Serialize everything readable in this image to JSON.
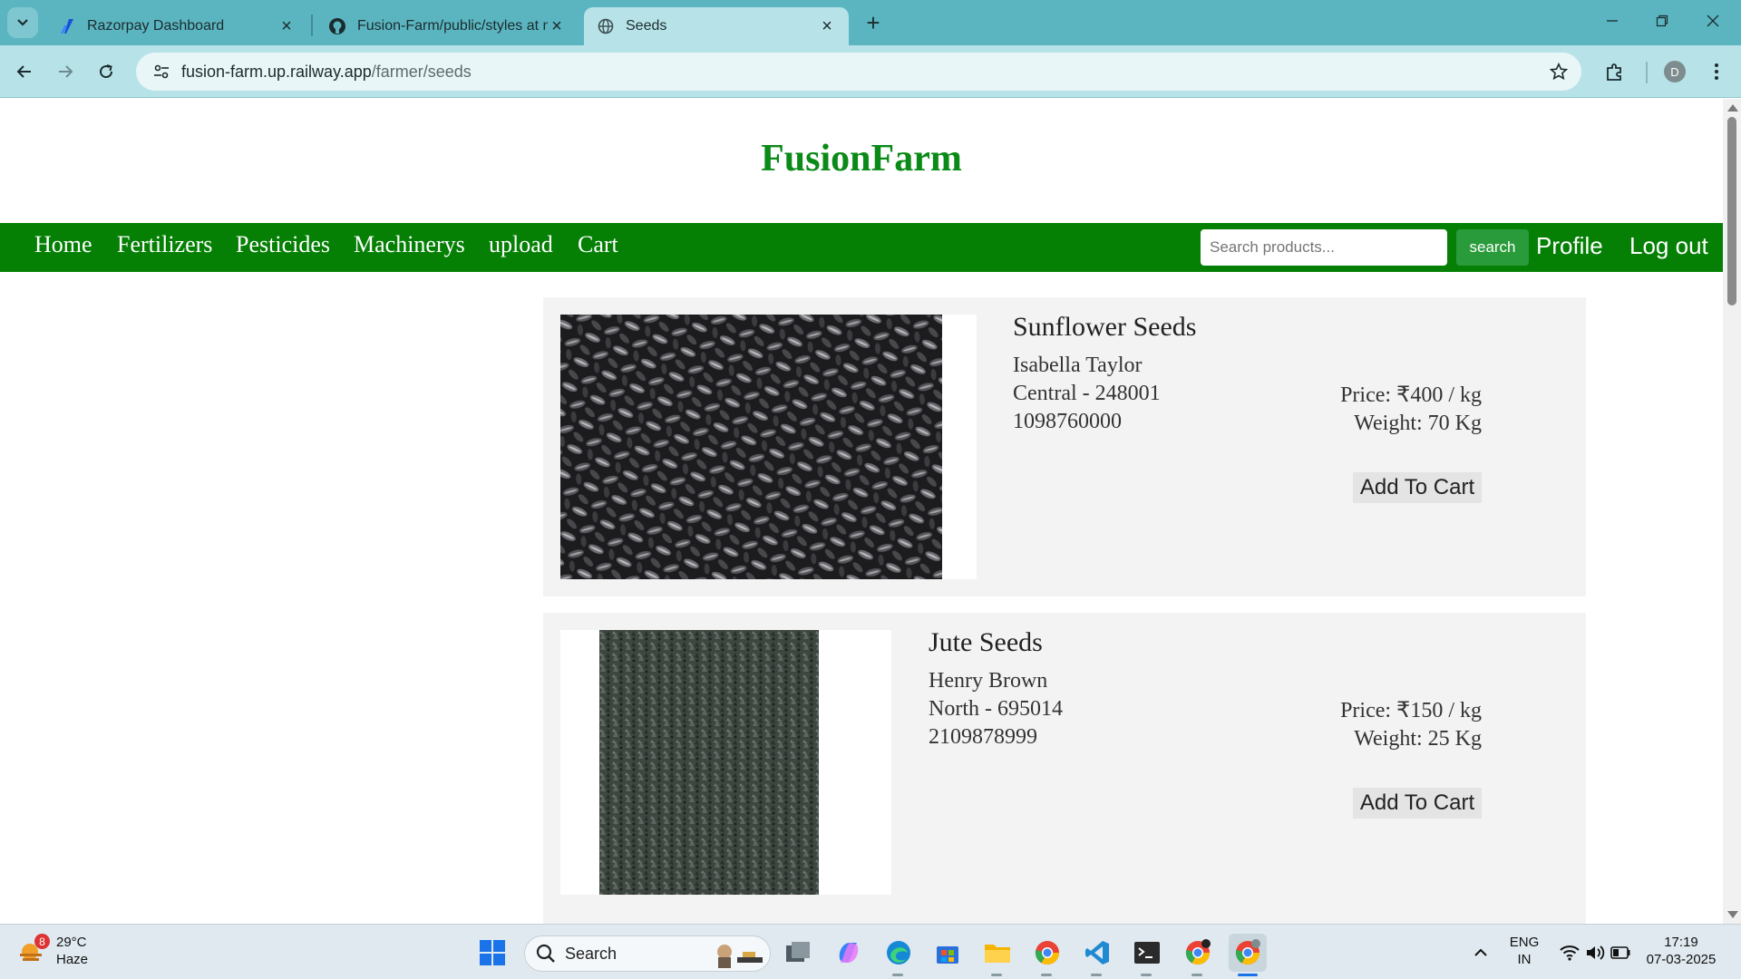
{
  "browser": {
    "tabs": [
      {
        "title": "Razorpay Dashboard",
        "icon": "razorpay-icon"
      },
      {
        "title": "Fusion-Farm/public/styles at m",
        "icon": "github-icon"
      },
      {
        "title": "Seeds",
        "icon": "globe-icon"
      }
    ],
    "url_host": "fusion-farm.up.railway.app",
    "url_path": "/farmer/seeds",
    "profile_initial": "D"
  },
  "site": {
    "brand": "FusionFarm",
    "nav": [
      "Home",
      "Fertilizers",
      "Pesticides",
      "Machinerys",
      "upload",
      "Cart"
    ],
    "search_placeholder": "Search products...",
    "search_button": "search",
    "profile": "Profile",
    "logout": "Log out"
  },
  "products": [
    {
      "name": "Sunflower Seeds",
      "seller": "Isabella Taylor",
      "location": "Central - 248001",
      "phone": "1098760000",
      "price": "Price: ₹400 / kg",
      "weight": "Weight: 70 Kg",
      "cart_label": "Add To Cart"
    },
    {
      "name": "Jute Seeds",
      "seller": "Henry Brown",
      "location": "North - 695014",
      "phone": "2109878999",
      "price": "Price: ₹150 / kg",
      "weight": "Weight: 25 Kg",
      "cart_label": "Add To Cart"
    }
  ],
  "taskbar": {
    "weather_temp": "29°C",
    "weather_desc": "Haze",
    "weather_badge": "8",
    "search_label": "Search",
    "lang_top": "ENG",
    "lang_bottom": "IN",
    "time": "17:19",
    "date": "07-03-2025"
  },
  "colors": {
    "brand_green": "#0a8a16",
    "nav_green": "#058005",
    "search_button": "#2a9b3b",
    "tabstrip": "#5bb5c0"
  }
}
